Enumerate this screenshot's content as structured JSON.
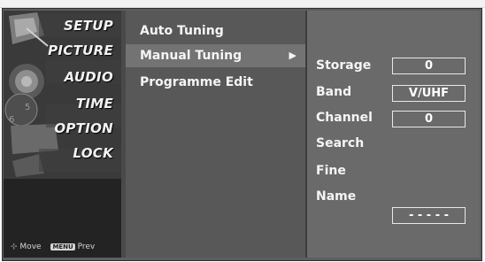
{
  "categories": [
    {
      "label": "SETUP",
      "active": true
    },
    {
      "label": "PICTURE",
      "active": false
    },
    {
      "label": "AUDIO",
      "active": false
    },
    {
      "label": "TIME",
      "active": false
    },
    {
      "label": "OPTION",
      "active": false
    },
    {
      "label": "LOCK",
      "active": false
    }
  ],
  "help": {
    "move_label": "Move",
    "menu_badge": "MENU",
    "prev_label": "Prev"
  },
  "menu": {
    "items": [
      {
        "label": "Auto Tuning",
        "selected": false
      },
      {
        "label": "Manual Tuning",
        "selected": true,
        "arrow": "▶"
      },
      {
        "label": "Programme Edit",
        "selected": false
      }
    ]
  },
  "settings": {
    "storage": {
      "label": "Storage",
      "value": "0"
    },
    "band": {
      "label": "Band",
      "value": "V/UHF"
    },
    "channel": {
      "label": "Channel",
      "value": "0"
    },
    "search": {
      "label": "Search"
    },
    "fine": {
      "label": "Fine"
    },
    "name": {
      "label": "Name",
      "value": "- - - - -"
    }
  },
  "colors": {
    "panel_dark": "#262626",
    "menu_bg": "#585858",
    "menu_selected": "#737373",
    "detail_bg": "#6a6a6a",
    "text": "#f5f5f5"
  }
}
